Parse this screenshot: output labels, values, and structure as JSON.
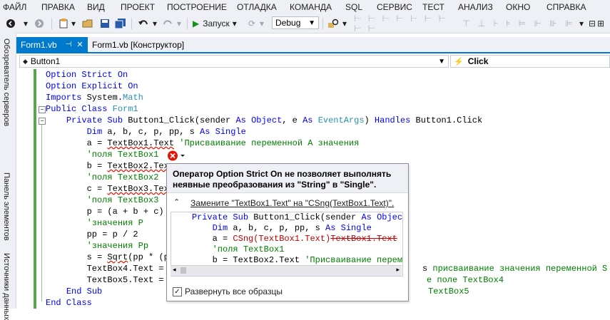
{
  "menu": [
    "ФАЙЛ",
    "ПРАВКА",
    "ВИД",
    "ПРОЕКТ",
    "ПОСТРОЕНИЕ",
    "ОТЛАДКА",
    "КОМАНДА",
    "SQL",
    "СЕРВИС",
    "ТЕСТ",
    "АНАЛИЗ",
    "ОКНО",
    "СПРАВКА"
  ],
  "toolbar": {
    "run_label": "Запуск",
    "config": "Debug"
  },
  "sidebar": {
    "tabs": [
      "Обозреватель серверов",
      "Панель элементов",
      "Источники данных"
    ]
  },
  "tabs": [
    {
      "label": "Form1.vb",
      "pin": "⊣"
    },
    {
      "label": "Form1.vb [Конструктор]"
    }
  ],
  "nav": {
    "object": "Button1",
    "event": "Click"
  },
  "code": [
    [
      [
        "kw",
        "Option Strict On"
      ]
    ],
    [
      [
        "kw",
        "Option Explicit On"
      ]
    ],
    [
      [
        "kw",
        "Imports "
      ],
      [
        "tx",
        "System."
      ],
      [
        "ty",
        "Math"
      ]
    ],
    [
      [
        "kw",
        "Public Class "
      ],
      [
        "ty",
        "Form1"
      ]
    ],
    [
      [
        "tx",
        "    "
      ],
      [
        "kw",
        "Private Sub "
      ],
      [
        "tx",
        "Button1_Click(sender "
      ],
      [
        "kw",
        "As Object"
      ],
      [
        "tx",
        ", e "
      ],
      [
        "kw",
        "As "
      ],
      [
        "ty",
        "EventArgs"
      ],
      [
        "tx",
        ") "
      ],
      [
        "kw",
        "Handles "
      ],
      [
        "tx",
        "Button1.Click"
      ]
    ],
    [
      [
        "tx",
        "        "
      ],
      [
        "kw",
        "Dim "
      ],
      [
        "tx",
        "a, b, c, p, pp, s "
      ],
      [
        "kw",
        "As Single"
      ]
    ],
    [
      [
        "tx",
        "        a = "
      ],
      [
        "err",
        "TextBox1.Text"
      ],
      [
        "tx",
        " "
      ],
      [
        "cm",
        "'Присваивание переменной А значения"
      ]
    ],
    [
      [
        "tx",
        "        "
      ],
      [
        "cm",
        "'поля TextBox1"
      ]
    ],
    [
      [
        "tx",
        "        b = "
      ],
      [
        "err",
        "TextBox2.Tex"
      ]
    ],
    [
      [
        "tx",
        "        "
      ],
      [
        "cm",
        "'поля TextBox2"
      ]
    ],
    [
      [
        "tx",
        "        c = "
      ],
      [
        "err",
        "TextBox3.Tex"
      ]
    ],
    [
      [
        "tx",
        "        "
      ],
      [
        "cm",
        "'поля TextBox3"
      ]
    ],
    [
      [
        "tx",
        "        p = (a + b + c)"
      ]
    ],
    [
      [
        "tx",
        "        "
      ],
      [
        "cm",
        "'значения P"
      ]
    ],
    [
      [
        "tx",
        "        pp = p / 2"
      ]
    ],
    [
      [
        "tx",
        "        "
      ],
      [
        "cm",
        "'значения Pp"
      ]
    ],
    [
      [
        "tx",
        "        s = "
      ],
      [
        "err",
        "Sqrt"
      ],
      [
        "tx",
        "(pp * (p"
      ]
    ],
    [
      [
        "tx",
        "        TextBox4.Text = "
      ]
    ],
    [
      [
        "tx",
        "        TextBox5.Text = "
      ]
    ],
    [
      [
        "tx",
        "    "
      ],
      [
        "kw",
        "End Sub"
      ]
    ],
    [
      [
        "kw",
        "End Class"
      ]
    ]
  ],
  "code_tail": [
    {
      "line": 17,
      "segs": [
        [
          "tx",
          "s "
        ],
        [
          "cm",
          "присваивание значения переменной S"
        ]
      ]
    },
    {
      "line": 18,
      "segs": [
        [
          "cm",
          "е поле TextBox4"
        ]
      ]
    },
    {
      "line": 19,
      "segs": [
        [
          "cm",
          "TextBox5"
        ]
      ]
    }
  ],
  "popup": {
    "title_line1": "Оператор Option Strict On не позволяет выполнять",
    "title_line2": "неявные преобразования из \"String\" в \"Single\".",
    "fix": "Замените \"TextBox1.Text\" на \"CSng(TextBox1.Text)\".",
    "preview": [
      [
        [
          "tx",
          "    "
        ],
        [
          "kw",
          "Private Sub "
        ],
        [
          "tx",
          "Button1_Click(sender "
        ],
        [
          "kw",
          "As Object"
        ]
      ],
      [
        [
          "tx",
          "        "
        ],
        [
          "kw",
          "Dim "
        ],
        [
          "tx",
          "a, b, c, p, pp, s "
        ],
        [
          "kw",
          "As Single"
        ]
      ],
      [
        [
          "tx",
          "        a = "
        ],
        [
          "ins",
          "CSng(TextBox1.Text)"
        ],
        [
          "strike",
          "TextBox1.Text"
        ],
        [
          "tx",
          " '"
        ]
      ],
      [
        [
          "tx",
          "        "
        ],
        [
          "cm",
          "'поля TextBox1"
        ]
      ],
      [
        [
          "tx",
          "        b = TextBox2.Text "
        ],
        [
          "cm",
          "'Присваивание переменной и присваивание значения переменной S"
        ]
      ]
    ],
    "expand_label": "Развернуть все образцы",
    "expand_checked": true
  },
  "colors": {
    "accent": "#007acc",
    "keyword": "#0000ff",
    "type": "#2b91af",
    "comment": "#008000",
    "error": "#e51400"
  }
}
